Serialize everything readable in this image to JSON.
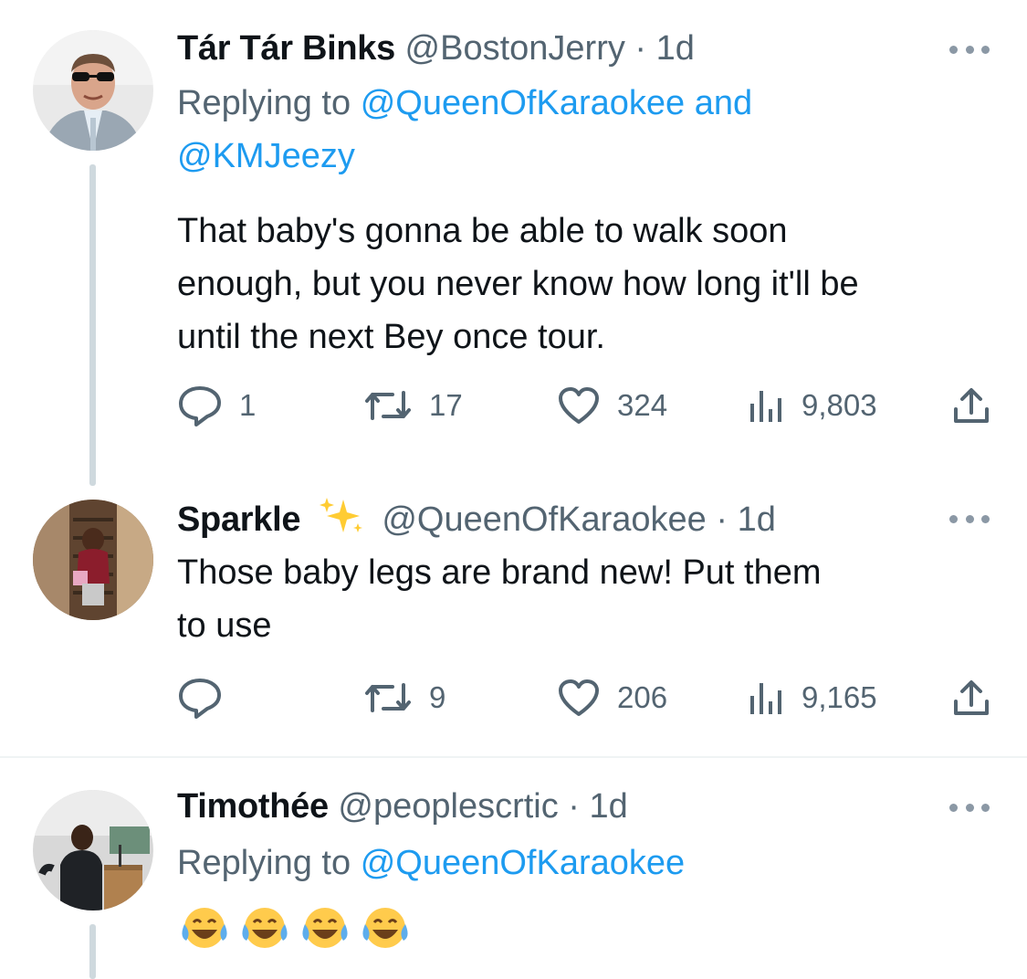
{
  "colors": {
    "text": "#0f1419",
    "secondary": "#536471",
    "link": "#1d9bf0",
    "line": "#cfd9de"
  },
  "tweets": [
    {
      "name": "Tár Tár Binks",
      "handle": "@BostonJerry",
      "separator": "·",
      "time": "1d",
      "replying_prefix": "Replying to",
      "mention_1": "@QueenOfKaraokee and",
      "mention_2": "@KMJeezy",
      "text_lines": [
        "That baby's gonna be able to walk soon",
        "enough, but you never know how long it'll be",
        "until the next Bey once tour."
      ],
      "replies": "1",
      "retweets": "17",
      "likes": "324",
      "views": "9,803"
    },
    {
      "name": "Sparkle",
      "name_emoji": "sparkles-emoji",
      "handle": "@QueenOfKaraokee",
      "separator": "·",
      "time": "1d",
      "text_lines": [
        "Those baby legs are brand new! Put them",
        "to use"
      ],
      "replies": "",
      "retweets": "9",
      "likes": "206",
      "views": "9,165"
    },
    {
      "name": "Timothée",
      "handle": "@peoplescrtic",
      "separator": "·",
      "time": "1d",
      "replying_prefix": "Replying to",
      "mention_1": "@QueenOfKaraokee",
      "emoji_text": [
        "face-with-tears-of-joy-emoji",
        "face-with-tears-of-joy-emoji",
        "face-with-tears-of-joy-emoji",
        "face-with-tears-of-joy-emoji"
      ]
    }
  ]
}
